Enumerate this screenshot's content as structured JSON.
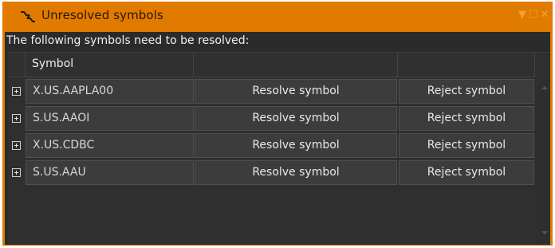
{
  "window": {
    "title": "Unresolved symbols",
    "icon": "link-icon",
    "controls": {
      "pin": "▼",
      "maximize": "☐",
      "close": "✕"
    }
  },
  "content": {
    "caption": "The following symbols need to be resolved:"
  },
  "table": {
    "headers": [
      "Symbol",
      "",
      ""
    ],
    "rows": [
      {
        "symbol": "X.US.AAPLA00",
        "resolve": "Resolve symbol",
        "reject": "Reject symbol"
      },
      {
        "symbol": "S.US.AAOI",
        "resolve": "Resolve symbol",
        "reject": "Reject symbol"
      },
      {
        "symbol": "X.US.CDBC",
        "resolve": "Resolve symbol",
        "reject": "Reject symbol"
      },
      {
        "symbol": "S.US.AAU",
        "resolve": "Resolve symbol",
        "reject": "Reject symbol"
      }
    ]
  },
  "colors": {
    "accent": "#e07b00",
    "background": "#2b2b2b",
    "cell": "#3c3c3c"
  }
}
